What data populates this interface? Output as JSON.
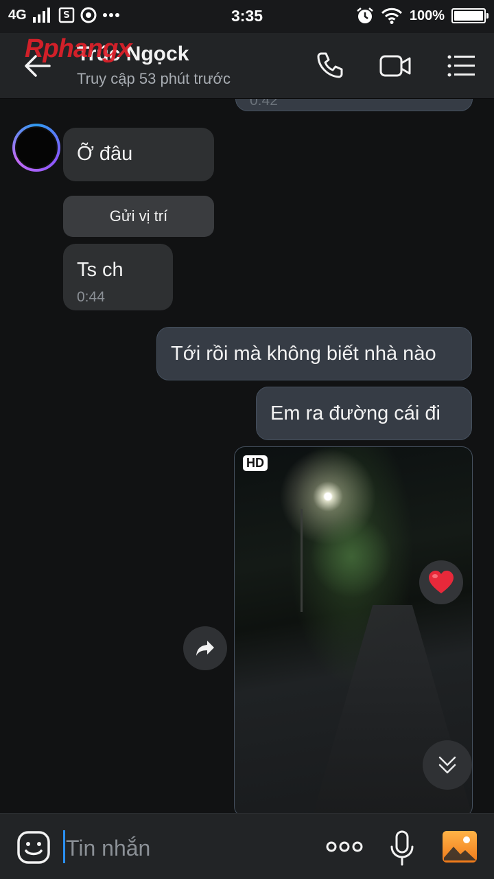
{
  "status_bar": {
    "network": "4G",
    "time": "3:35",
    "battery": "100%",
    "icons": [
      "signal-icon",
      "screenshot-icon",
      "chrome-icon",
      "more-dots-icon",
      "alarm-icon",
      "wifi-icon",
      "battery-icon"
    ]
  },
  "header": {
    "watermark_part1": "Rphang",
    "watermark_part2": "x",
    "contact_name": "Trúc Ngọck",
    "last_seen": "Truy cập 53 phút trước",
    "icons": [
      "back-arrow-icon",
      "phone-icon",
      "video-camera-icon",
      "menu-list-icon"
    ]
  },
  "messages": {
    "prev_time": "0:42",
    "m1_text": "Ỡ đâu",
    "m2_text": "Gửi vị trí",
    "m3_text": "Ts ch",
    "m3_time": "0:44",
    "m4_text": "Tới rồi mà không biết nhà nào",
    "m5_text": "Em ra đường cái đi",
    "photo_badge": "HD"
  },
  "input_bar": {
    "placeholder": "Tin nhắn",
    "icons": [
      "emoji-icon",
      "more-options-icon",
      "microphone-icon",
      "gallery-icon"
    ]
  },
  "colors": {
    "background": "#111213",
    "incoming_bubble": "#2e3032",
    "outgoing_bubble": "#363c45",
    "accent": "#2a8ff0",
    "heart": "#e8293a"
  }
}
